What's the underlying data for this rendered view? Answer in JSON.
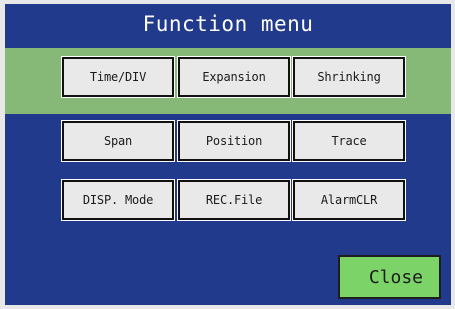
{
  "title": "Function menu",
  "buttons": {
    "time_div": "Time/DIV",
    "expansion": "Expansion",
    "shrinking": "Shrinking",
    "span": "Span",
    "position": "Position",
    "trace": "Trace",
    "disp_mode": "DISP. Mode",
    "rec_file": "REC.File",
    "alarm_clr": "AlarmCLR",
    "close": "Close"
  },
  "colors": {
    "panel_bg": "#213a8b",
    "highlight_band": "#86b978",
    "button_bg": "#e9e9e9",
    "close_bg": "#7cd468"
  }
}
